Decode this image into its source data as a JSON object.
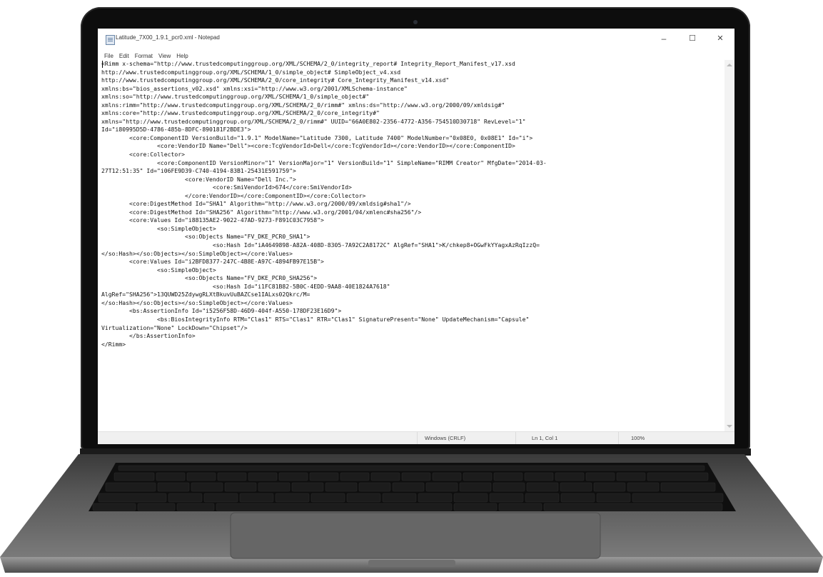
{
  "window": {
    "title": "Latitude_7X00_1.9.1_pcr0.xml - Notepad",
    "minimize_glyph": "–",
    "maximize_glyph": "☐",
    "close_glyph": "✕"
  },
  "menu": {
    "items": [
      "File",
      "Edit",
      "Format",
      "View",
      "Help"
    ]
  },
  "editor": {
    "content": "<Rimm x-schema=\"http://www.trustedcomputinggroup.org/XML/SCHEMA/2_0/integrity_report# Integrity_Report_Manifest_v17.xsd\nhttp://www.trustedcomputinggroup.org/XML/SCHEMA/1_0/simple_object# SimpleObject_v4.xsd\nhttp://www.trustedcomputinggroup.org/XML/SCHEMA/2_0/core_integrity# Core_Integrity_Manifest_v14.xsd\"\nxmlns:bs=\"bios_assertions_v02.xsd\" xmlns:xsi=\"http://www.w3.org/2001/XMLSchema-instance\"\nxmlns:so=\"http://www.trustedcomputinggroup.org/XML/SCHEMA/1_0/simple_object#\"\nxmlns:rimm=\"http://www.trustedcomputinggroup.org/XML/SCHEMA/2_0/rimm#\" xmlns:ds=\"http://www.w3.org/2000/09/xmldsig#\"\nxmlns:core=\"http://www.trustedcomputinggroup.org/XML/SCHEMA/2_0/core_integrity#\"\nxmlns=\"http://www.trustedcomputinggroup.org/XML/SCHEMA/2_0/rimm#\" UUID=\"66A0E802-2356-4772-A356-754510D30718\" RevLevel=\"1\"\nId=\"i80995D5D-4786-485b-8DFC-890181F2BDE3\">\n        <core:ComponentID VersionBuild=\"1.9.1\" ModelName=\"Latitude 7300, Latitude 7400\" ModelNumber=\"0x08E0, 0x08E1\" Id=\"i\">\n                <core:VendorID Name=\"Dell\"><core:TcgVendorId>Dell</core:TcgVendorId></core:VendorID></core:ComponentID>\n        <core:Collector>\n                <core:ComponentID VersionMinor=\"1\" VersionMajor=\"1\" VersionBuild=\"1\" SimpleName=\"RIMM Creator\" MfgDate=\"2014-03-\n27T12:51:35\" Id=\"i06FE9D39-C740-4194-83B1-25431E591759\">\n                        <core:VendorID Name=\"Dell Inc.\">\n                                <core:SmiVendorId>674</core:SmiVendorId>\n                        </core:VendorID></core:ComponentID></core:Collector>\n        <core:DigestMethod Id=\"SHA1\" Algorithm=\"http://www.w3.org/2000/09/xmldsig#sha1\"/>\n        <core:DigestMethod Id=\"SHA256\" Algorithm=\"http://www.w3.org/2001/04/xmlenc#sha256\"/>\n        <core:Values Id=\"i88135AE2-9022-47AD-9273-F891C03C7958\">\n                <so:SimpleObject>\n                        <so:Objects Name=\"FV_DKE_PCR0_SHA1\">\n                                <so:Hash Id=\"iA4649898-A82A-408D-8305-7A92C2A8172C\" AlgRef=\"SHA1\">K/chkep8+OGwFkYYagxAzRqIzzQ=\n</so:Hash></so:Objects></so:SimpleObject></core:Values>\n        <core:Values Id=\"i2BFD8377-247C-4B8E-A97C-4894FB97E15B\">\n                <so:SimpleObject>\n                        <so:Objects Name=\"FV_DKE_PCR0_SHA256\">\n                                <so:Hash Id=\"i1FC81B82-5B0C-4EDD-9AA8-40E1824A7618\"\nAlgRef=\"SHA256\">13QUWD25ZdywgRLXtBkuvUuBAZCse1IALxs02Qkrc/M=\n</so:Hash></so:Objects></so:SimpleObject></core:Values>\n        <bs:AssertionInfo Id=\"i5256F58D-46D9-404f-A550-178DF23E16D9\">\n                <bs:BiosIntegrityInfo RTM=\"Clas1\" RTS=\"Clas1\" RTR=\"Clas1\" SignaturePresent=\"None\" UpdateMechanism=\"Capsule\"\nVirtualization=\"None\" LockDown=\"Chipset\"/>\n        </bs:AssertionInfo>\n</Rimm>"
  },
  "statusbar": {
    "line_ending": "Windows (CRLF)",
    "position": "Ln 1, Col 1",
    "zoom": "100%"
  },
  "colors": {
    "laptop_bezel": "#0d0d0d",
    "laptop_body": "#8a8a8a",
    "keyboard_deck": "#2c2c2c",
    "notepad_bg": "#ffffff",
    "status_bg": "#f0f0f0"
  }
}
